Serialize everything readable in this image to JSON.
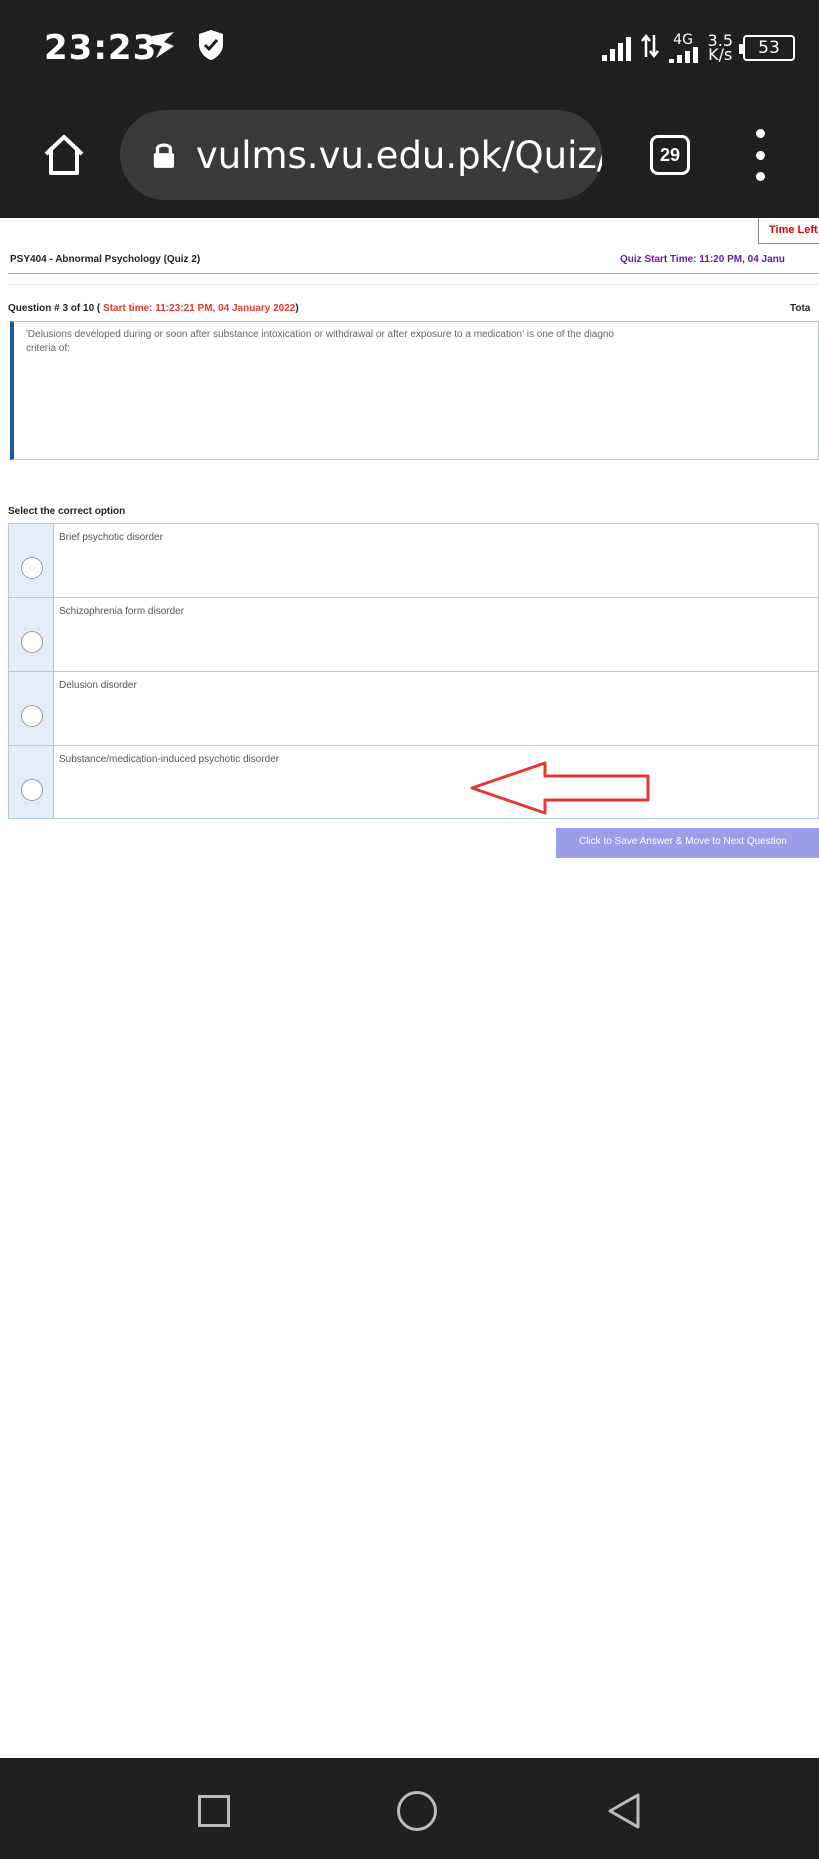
{
  "status_bar": {
    "time": "23:23",
    "network_type": "4G",
    "speed_value": "3.5",
    "speed_unit": "K/s",
    "battery": "53",
    "icons": [
      "app-notification-icon",
      "shield-check-icon",
      "signal-icon",
      "data-transfer-icon",
      "signal-4g-icon",
      "battery-icon"
    ]
  },
  "browser": {
    "url": "vulms.vu.edu.pk/Quiz/Q",
    "tab_count": "29"
  },
  "quiz": {
    "time_left_label": "Time Left",
    "course_title": "PSY404 - Abnormal Psychology (Quiz 2)",
    "quiz_start": "Quiz Start Time: 11:20 PM, 04 Janu",
    "question_number": "Question # 3 of 10 (",
    "start_time": "Start time: 11:23:21 PM, 04 January 2022",
    "question_close": ")",
    "total_label": "Tota",
    "question_line1": "'Delusions developed during or soon after substance intoxication or withdrawal or after exposure to a medication' is one of the diagno",
    "question_line2": "criteria of:",
    "select_label": "Select the correct option",
    "options": [
      {
        "label": "Brief psychotic disorder"
      },
      {
        "label": "Schizophrenia form disorder"
      },
      {
        "label": "Delusion disorder"
      },
      {
        "label": "Substance/medication-induced psychotic disorder"
      }
    ],
    "next_button": "Click to Save Answer & Move to Next Question"
  },
  "annotation": {
    "arrow_color": "#e53935"
  },
  "colors": {
    "system_bar": "#202020",
    "start_time_red": "#e53935",
    "quiz_start_purple": "#6a1b9a",
    "question_border": "#1e5b94",
    "next_button": "#9a9de8"
  }
}
